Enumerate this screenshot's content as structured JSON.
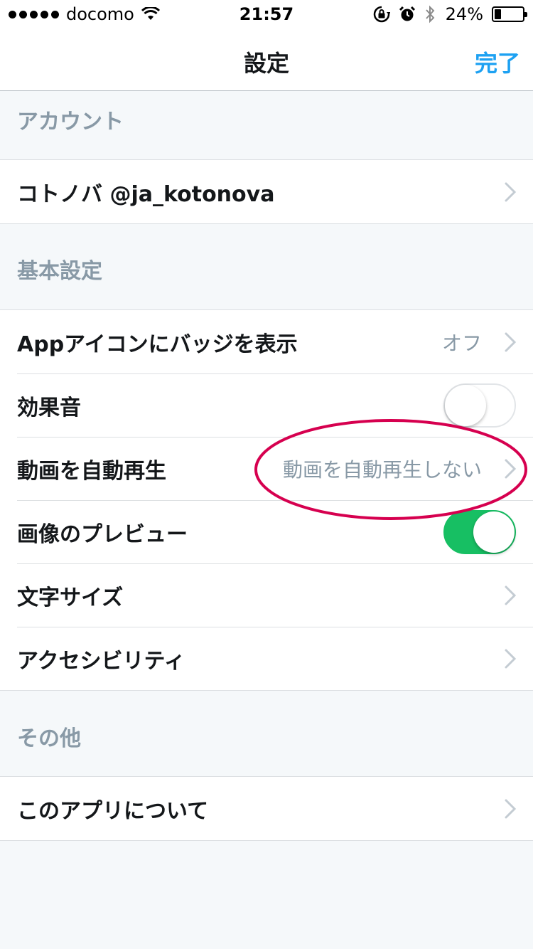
{
  "status_bar": {
    "carrier": "docomo",
    "time": "21:57",
    "battery_percent": "24%",
    "battery_level": 0.24,
    "icons": [
      "signal-dots-icon",
      "wifi-icon",
      "rotation-lock-icon",
      "alarm-icon",
      "bluetooth-icon",
      "battery-icon"
    ]
  },
  "nav": {
    "title": "設定",
    "done_label": "完了"
  },
  "sections": {
    "account": {
      "header": "アカウント",
      "rows": [
        {
          "label": "コトノバ @ja_kotonova"
        }
      ]
    },
    "basic": {
      "header": "基本設定",
      "rows": [
        {
          "label": "Appアイコンにバッジを表示",
          "value": "オフ"
        },
        {
          "label": "効果音",
          "toggle": "off"
        },
        {
          "label": "動画を自動再生",
          "value": "動画を自動再生しない"
        },
        {
          "label": "画像のプレビュー",
          "toggle": "on"
        },
        {
          "label": "文字サイズ"
        },
        {
          "label": "アクセシビリティ"
        }
      ]
    },
    "other": {
      "header": "その他",
      "rows": [
        {
          "label": "このアプリについて"
        }
      ]
    }
  },
  "colors": {
    "accent": "#1da1f2",
    "toggle_on": "#17bf63",
    "section_header_text": "#8899a6",
    "annotation": "#d6004f"
  }
}
